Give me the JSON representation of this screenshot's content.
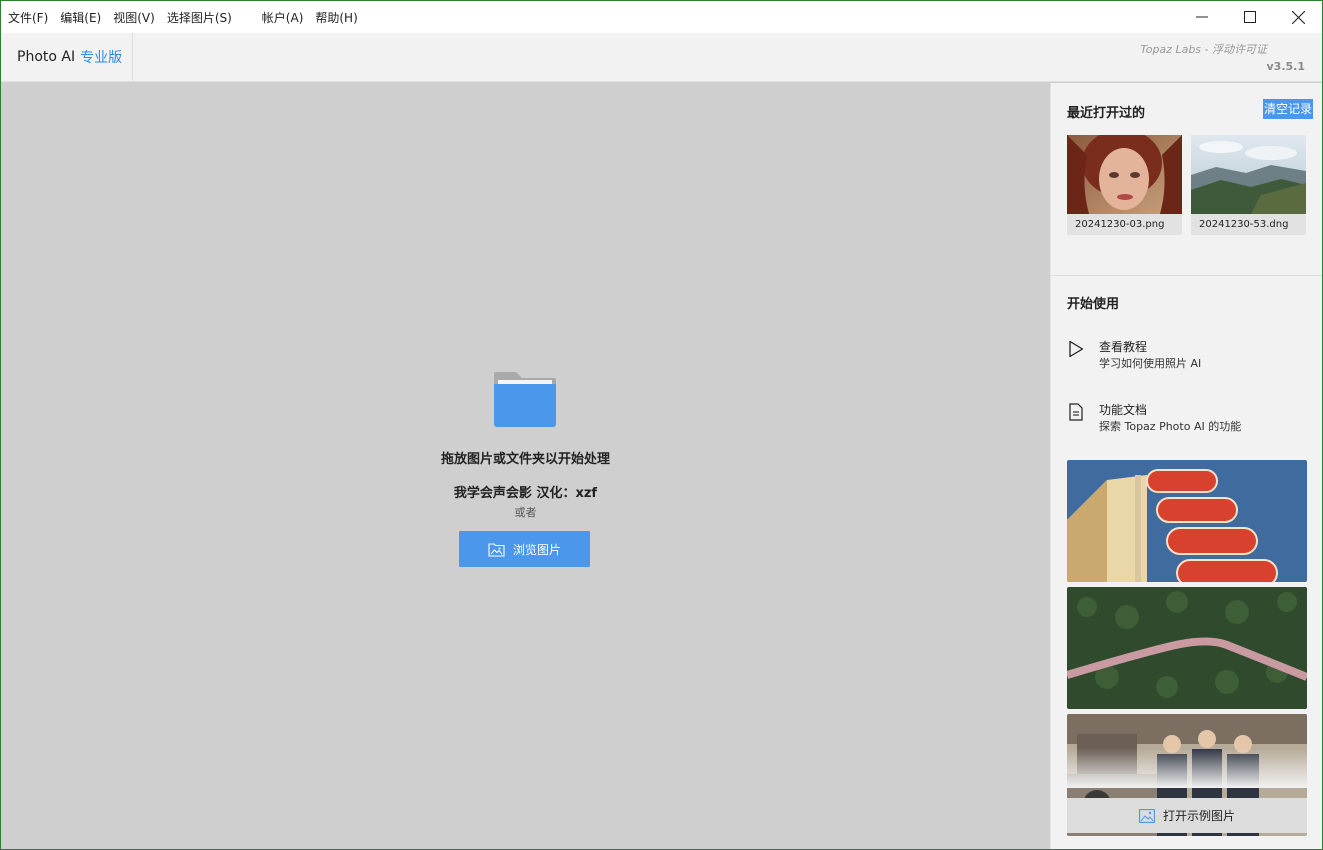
{
  "menu": {
    "items": [
      "文件(F)",
      "编辑(E)",
      "视图(V)",
      "选择图片(S)",
      "帐户(A)",
      "帮助(H)"
    ]
  },
  "window_controls": [
    "minimize-icon",
    "maximize-icon",
    "close-icon"
  ],
  "header": {
    "app_name": "Photo AI",
    "edition": "专业版",
    "license": "Topaz Labs - 浮动许可证",
    "version": "v3.5.1"
  },
  "dropzone": {
    "title": "拖放图片或文件夹以开始处理",
    "credit": "我学会声会影  汉化：xzf",
    "or": "或者",
    "browse_label": "浏览图片"
  },
  "sidebar": {
    "recent_title": "最近打开过的",
    "clear_label": "清空记录",
    "recent": [
      {
        "name": "20241230-03.png"
      },
      {
        "name": "20241230-53.dng"
      }
    ],
    "start_title": "开始使用",
    "start_items": [
      {
        "icon": "play-icon",
        "title": "查看教程",
        "subtitle": "学习如何使用照片 AI"
      },
      {
        "icon": "document-icon",
        "title": "功能文档",
        "subtitle": "探索 Topaz Photo AI 的功能"
      }
    ],
    "open_sample_label": "打开示例图片"
  },
  "colors": {
    "accent": "#4a97ec",
    "edition": "#2b8be6",
    "workspace": "#cfcfcf",
    "sidebar": "#f2f2f2"
  }
}
